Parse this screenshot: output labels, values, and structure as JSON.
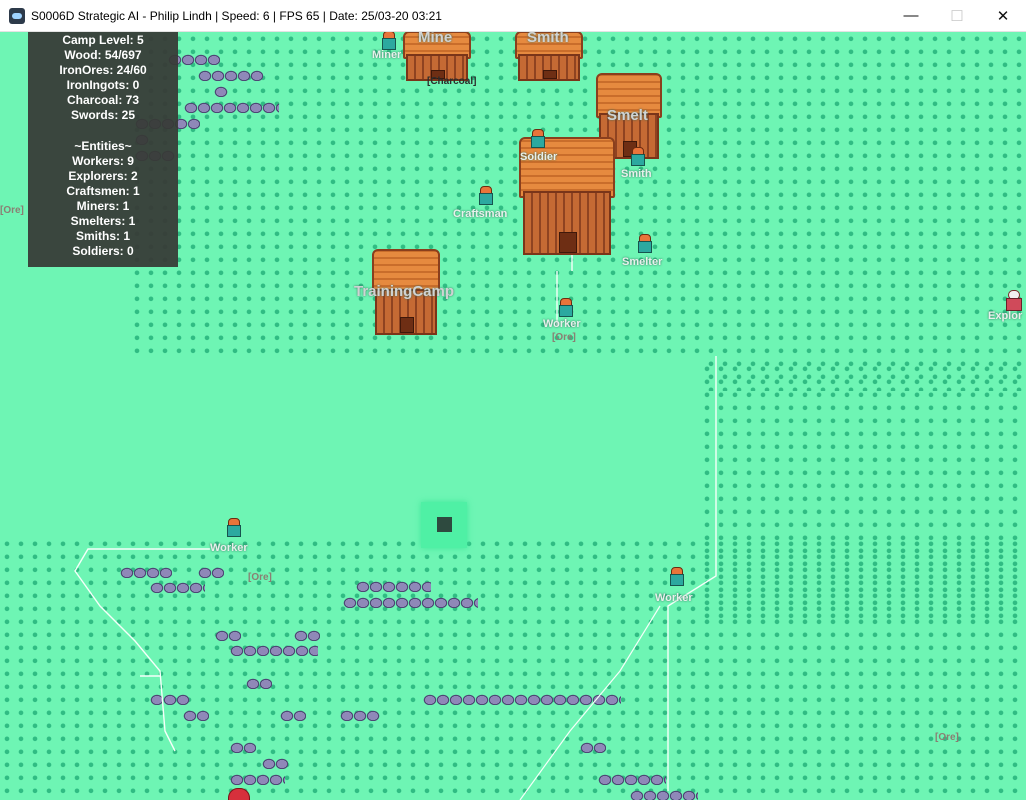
{
  "window": {
    "title": "S0006D Strategic AI - Philip Lindh | Speed: 6 | FPS 65 | Date: 25/03-20 03:21",
    "controls": {
      "minimize": "—",
      "maximize": "☐",
      "close": "✕"
    }
  },
  "stats": {
    "camp_level": "Camp Level: 5",
    "wood": "Wood: 54/697",
    "iron_ores": "IronOres: 24/60",
    "iron_ingots": "IronIngots: 0",
    "charcoal": "Charcoal: 73",
    "swords": "Swords: 25",
    "entities_header": "~Entities~",
    "workers": "Workers: 9",
    "explorers": "Explorers: 2",
    "craftsmen": "Craftsmen: 1",
    "miners": "Miners: 1",
    "smelters": "Smelters: 1",
    "smiths": "Smiths: 1",
    "soldiers": "Soldiers: 0"
  },
  "buildings": {
    "mine": "Mine",
    "smith": "Smith",
    "smelt": "Smelt",
    "training_camp": "TrainingCamp",
    "charcoal_tag": "[Charcoal]"
  },
  "entities": {
    "miner": "Miner",
    "soldier": "Soldier",
    "smith": "Smith",
    "craftsman": "Craftsman",
    "smelter": "Smelter",
    "worker_1": "Worker",
    "worker_2": "Worker",
    "worker_3": "Worker",
    "explorer": "Explor"
  },
  "ore_tags": {
    "left_edge": "[Ore]",
    "near_worker": "[Ore]",
    "mid_left": "[Ore]",
    "bottom_right": "[Ore]"
  },
  "colors": {
    "ground": "#6ef5b4",
    "grass": "#29b67e",
    "panel": "#373a36",
    "selection": "#4ff0a5"
  }
}
